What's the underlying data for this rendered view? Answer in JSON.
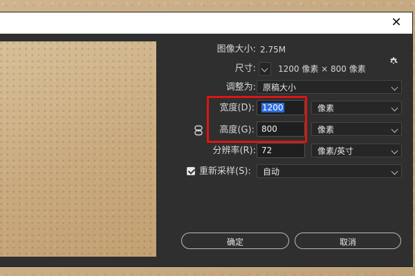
{
  "dialog": {
    "image_size_label": "图像大小:",
    "image_size_value": "2.75M",
    "dimensions_label": "尺寸:",
    "dimensions_value": "1200 像素 × 800 像素",
    "fit_to_label": "调整为:",
    "fit_to_value": "原稿大小",
    "width_label": "宽度(D):",
    "width_value": "1200",
    "width_unit": "像素",
    "height_label": "高度(G):",
    "height_value": "800",
    "height_unit": "像素",
    "resolution_label": "分辨率(R):",
    "resolution_value": "72",
    "resolution_unit": "像素/英寸",
    "resample_label": "重新采样(S):",
    "resample_value": "自动",
    "ok_label": "确定",
    "cancel_label": "取消"
  },
  "icons": {
    "close": "close-icon",
    "settings": "gear-icon",
    "link": "link-icon"
  },
  "colors": {
    "dialog_bg": "#2f2f2f",
    "highlight": "#e01414",
    "selection": "#2d6cdf"
  }
}
